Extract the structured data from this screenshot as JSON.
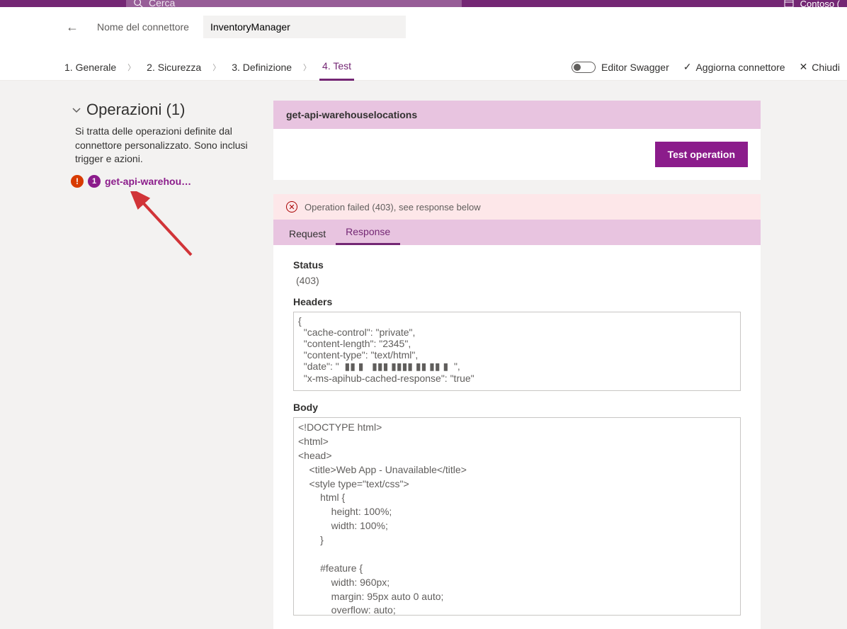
{
  "top": {
    "search_placeholder": "Cerca",
    "user_label": "Contoso ("
  },
  "connector": {
    "label": "Nome del connettore",
    "value": "InventoryManager"
  },
  "steps": {
    "s1": "1. Generale",
    "s2": "2. Sicurezza",
    "s3": "3. Definizione",
    "s4": "4. Test",
    "swagger": "Editor Swagger",
    "update": "Aggiorna connettore",
    "close": "Chiudi"
  },
  "sidebar": {
    "operations_title": "Operazioni (1)",
    "operations_desc": "Si tratta delle operazioni definite dal connettore personalizzato. Sono inclusi trigger e azioni.",
    "op_badge": "1",
    "op_name": "get-api-warehou…"
  },
  "main": {
    "operation_title": "get-api-warehouselocations",
    "test_button": "Test operation",
    "error_text": "Operation failed (403), see response below",
    "tabs": {
      "request": "Request",
      "response": "Response"
    },
    "status_label": "Status",
    "status_value": "(403)",
    "headers_label": "Headers",
    "headers_text": "{\n  \"cache-control\": \"private\",\n  \"content-length\": \"2345\",\n  \"content-type\": \"text/html\",\n  \"date\": \"  ▮▮ ▮   ▮▮▮ ▮▮▮▮ ▮▮ ▮▮ ▮  \",\n  \"x-ms-apihub-cached-response\": \"true\"",
    "body_label": "Body",
    "body_text": "<!DOCTYPE html>\n<html>\n<head>\n    <title>Web App - Unavailable</title>\n    <style type=\"text/css\">\n        html {\n            height: 100%;\n            width: 100%;\n        }\n\n        #feature {\n            width: 960px;\n            margin: 95px auto 0 auto;\n            overflow: auto;"
  }
}
